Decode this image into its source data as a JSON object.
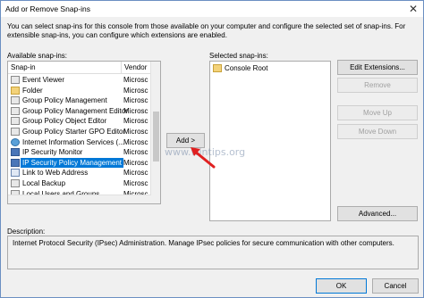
{
  "window": {
    "title": "Add or Remove Snap-ins",
    "close_glyph": "✕"
  },
  "intro": "You can select snap-ins for this console from those available on your computer and configure the selected set of snap-ins. For extensible snap-ins, you can configure which extensions are enabled.",
  "available": {
    "label": "Available snap-ins:",
    "col_snapin": "Snap-in",
    "col_vendor": "Vendor",
    "items": [
      {
        "name": "Event Viewer",
        "vendor": "Microsc",
        "icon": "viewer-icon",
        "selected": false
      },
      {
        "name": "Folder",
        "vendor": "Microsc",
        "icon": "folder-icon",
        "selected": false
      },
      {
        "name": "Group Policy Management",
        "vendor": "Microsc",
        "icon": "gpo-icon",
        "selected": false
      },
      {
        "name": "Group Policy Management Editor",
        "vendor": "Microsc",
        "icon": "gpo-icon",
        "selected": false
      },
      {
        "name": "Group Policy Object Editor",
        "vendor": "Microsc",
        "icon": "gpo-icon",
        "selected": false
      },
      {
        "name": "Group Policy Starter GPO Editor",
        "vendor": "Microsc",
        "icon": "gpo-icon",
        "selected": false
      },
      {
        "name": "Internet Information Services (...",
        "vendor": "Microsc",
        "icon": "globe-icon",
        "selected": false
      },
      {
        "name": "IP Security Monitor",
        "vendor": "Microsc",
        "icon": "shield-icon",
        "selected": false
      },
      {
        "name": "IP Security Policy Management",
        "vendor": "Microsc",
        "icon": "shield-icon",
        "selected": true
      },
      {
        "name": "Link to Web Address",
        "vendor": "Microsc",
        "icon": "link-icon",
        "selected": false
      },
      {
        "name": "Local Backup",
        "vendor": "Microsc",
        "icon": "backup-icon",
        "selected": false
      },
      {
        "name": "Local Users and Groups",
        "vendor": "Microsc",
        "icon": "users-icon",
        "selected": false
      }
    ]
  },
  "add_button": "Add >",
  "watermark": "www.wintips.org",
  "selected": {
    "label": "Selected snap-ins:",
    "items": [
      {
        "name": "Console Root",
        "icon": "folder-icon"
      }
    ]
  },
  "side_buttons": {
    "edit_extensions": "Edit Extensions...",
    "remove": "Remove",
    "move_up": "Move Up",
    "move_down": "Move Down",
    "advanced": "Advanced..."
  },
  "description": {
    "label": "Description:",
    "text": "Internet Protocol Security (IPsec) Administration. Manage IPsec policies for secure communication with other computers."
  },
  "footer": {
    "ok": "OK",
    "cancel": "Cancel"
  },
  "colors": {
    "selection": "#0078d7",
    "arrow": "#e02020"
  }
}
